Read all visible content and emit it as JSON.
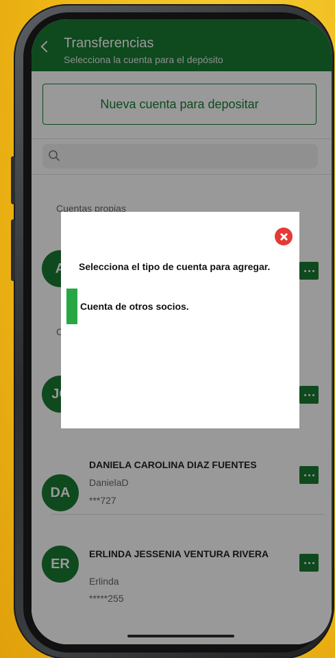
{
  "header": {
    "title": "Transferencias",
    "subtitle": "Selecciona la cuenta para el depósito"
  },
  "actions": {
    "new_account_label": "Nueva cuenta para depositar"
  },
  "search": {
    "placeholder": ""
  },
  "sections": {
    "own_accounts": "Cuentas propias",
    "other_partial": "C"
  },
  "accounts": [
    {
      "initials": "A",
      "name": "",
      "alias": "",
      "number": ""
    },
    {
      "initials": "JC",
      "name": "",
      "alias": "",
      "number": ""
    },
    {
      "initials": "DA",
      "name": "DANIELA CAROLINA DIAZ FUENTES",
      "alias": "DanielaD",
      "number": "***727"
    },
    {
      "initials": "ER",
      "name": "ERLINDA JESSENIA VENTURA RIVERA",
      "alias": "Erlinda",
      "number": "*****255"
    }
  ],
  "modal": {
    "title": "Selecciona el tipo de cuenta para agregar.",
    "option": "Cuenta de otros socios."
  },
  "colors": {
    "brand_green": "#1a7a32",
    "option_green": "#27a744",
    "close_red": "#e53935",
    "background_yellow": "#eeb716"
  }
}
